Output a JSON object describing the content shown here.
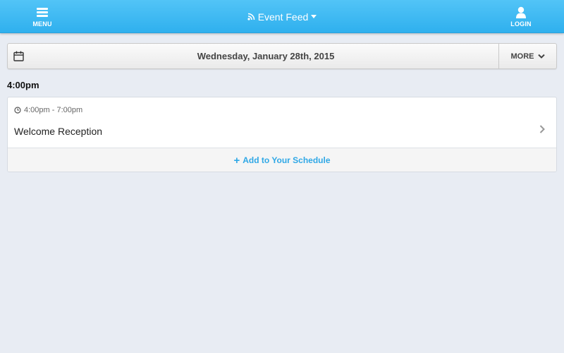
{
  "header": {
    "menu_label": "MENU",
    "title": "Event Feed",
    "login_label": "LOGIN",
    "icons": {
      "menu": "hamburger-icon",
      "title": "rss-icon",
      "title_caret": "caret-down-icon",
      "login": "user-icon"
    }
  },
  "datebar": {
    "date": "Wednesday, January 28th, 2015",
    "more_label": "MORE",
    "icons": {
      "calendar": "calendar-icon",
      "more": "chevron-down-icon"
    }
  },
  "schedule": {
    "time_heading": "4:00pm",
    "events": [
      {
        "time_range": "4:00pm - 7:00pm",
        "title": "Welcome Reception",
        "add_label": "Add to Your Schedule"
      }
    ]
  },
  "colors": {
    "header": "#3bb8f2",
    "accent": "#2fa8e6",
    "background": "#e8ecf3"
  }
}
